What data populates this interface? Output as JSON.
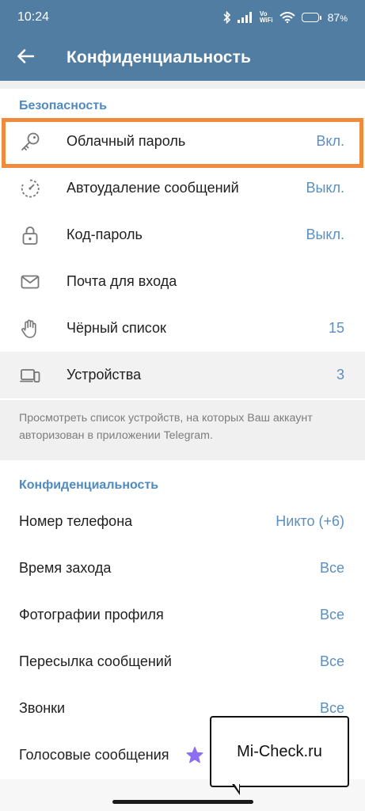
{
  "status_bar": {
    "time": "10:24",
    "network_label_top": "Vo",
    "network_label_bottom": "WiFi",
    "battery": "87",
    "battery_unit": "%",
    "battery_level": 0.87,
    "icons": [
      "bluetooth-icon",
      "signal-icon",
      "wifi-icon",
      "battery-icon"
    ]
  },
  "header": {
    "title": "Конфиденциальность",
    "back_icon": "arrow-left-icon"
  },
  "security": {
    "title": "Безопасность",
    "items": [
      {
        "icon": "key-icon",
        "label": "Облачный пароль",
        "value": "Вкл."
      },
      {
        "icon": "timer-icon",
        "label": "Автоудаление сообщений",
        "value": "Выкл."
      },
      {
        "icon": "lock-icon",
        "label": "Код-пароль",
        "value": "Выкл."
      },
      {
        "icon": "mail-icon",
        "label": "Почта для входа",
        "value": ""
      },
      {
        "icon": "hand-icon",
        "label": "Чёрный список",
        "value": "15"
      },
      {
        "icon": "devices-icon",
        "label": "Устройства",
        "value": "3"
      }
    ],
    "info": "Просмотреть список устройств, на которых Ваш аккаунт авторизован в приложении Telegram."
  },
  "privacy": {
    "title": "Конфиденциальность",
    "items": [
      {
        "label": "Номер телефона",
        "value": "Никто (+6)"
      },
      {
        "label": "Время захода",
        "value": "Все"
      },
      {
        "label": "Фотографии профиля",
        "value": "Все"
      },
      {
        "label": "Пересылка сообщений",
        "value": "Все"
      },
      {
        "label": "Звонки",
        "value": "Все"
      },
      {
        "label": "Голосовые сообщения",
        "value": "",
        "icon": "star-icon"
      }
    ]
  },
  "watermark": "Mi-Check.ru",
  "colors": {
    "header": "#527da3",
    "accent": "#4f8ac0",
    "value": "#5b8fbf",
    "highlight": "#f08a3c",
    "premium_star": "#8d6ef0"
  }
}
